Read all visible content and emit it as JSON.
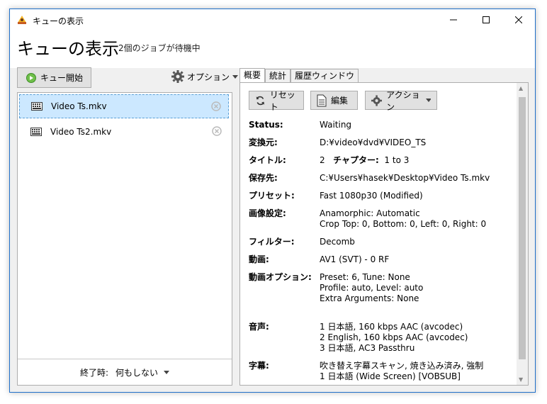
{
  "window": {
    "title": "キューの表示"
  },
  "header": {
    "title": "キューの表示",
    "subtitle": "2個のジョブが待機中"
  },
  "toolbar": {
    "start_label": "キュー開始",
    "options_label": "オプション"
  },
  "queue": {
    "items": [
      {
        "name": "Video Ts.mkv",
        "selected": true
      },
      {
        "name": "Video Ts2.mkv",
        "selected": false
      }
    ]
  },
  "footer": {
    "when_done_label": "終了時:",
    "when_done_value": "何もしない"
  },
  "tabs": [
    "概要",
    "統計",
    "履歴ウィンドウ"
  ],
  "actions": {
    "reset": "リセット",
    "edit": "編集",
    "action": "アクション"
  },
  "details": {
    "status": {
      "label": "Status:",
      "value": "Waiting"
    },
    "source": {
      "label": "変換元:",
      "value": "D:¥video¥dvd¥VIDEO_TS"
    },
    "title": {
      "label": "タイトル:",
      "value_title": "2",
      "chapter_label": "チャプター:",
      "chapter_value": "1 to 3"
    },
    "dest": {
      "label": "保存先:",
      "value": "C:¥Users¥hasek¥Desktop¥Video Ts.mkv"
    },
    "preset": {
      "label": "プリセット:",
      "value": "Fast 1080p30 (Modified)"
    },
    "picture": {
      "label": "画像設定:",
      "lines": [
        "Anamorphic: Automatic",
        "Crop Top: 0, Bottom: 0, Left: 0, Right: 0"
      ]
    },
    "filters": {
      "label": "フィルター:",
      "value": "Decomb"
    },
    "video": {
      "label": "動画:",
      "value": "AV1 (SVT) - 0 RF"
    },
    "video_options": {
      "label": "動画オプション:",
      "lines": [
        "Preset: 6, Tune: None",
        "Profile: auto, Level: auto",
        "Extra Arguments: None"
      ]
    },
    "audio": {
      "label": "音声:",
      "lines": [
        "1 日本語, 160 kbps AAC (avcodec)",
        "2 English, 160 kbps AAC (avcodec)",
        "3 日本語, AC3 Passthru"
      ]
    },
    "subtitles": {
      "label": "字幕:",
      "lines": [
        "吹き替え字幕スキャン, 焼き込み済み, 強制",
        "1 日本語 (Wide Screen) [VOBSUB]"
      ]
    }
  },
  "colors": {
    "accent": "#1f6fc9",
    "selected_bg": "#cce8ff"
  }
}
